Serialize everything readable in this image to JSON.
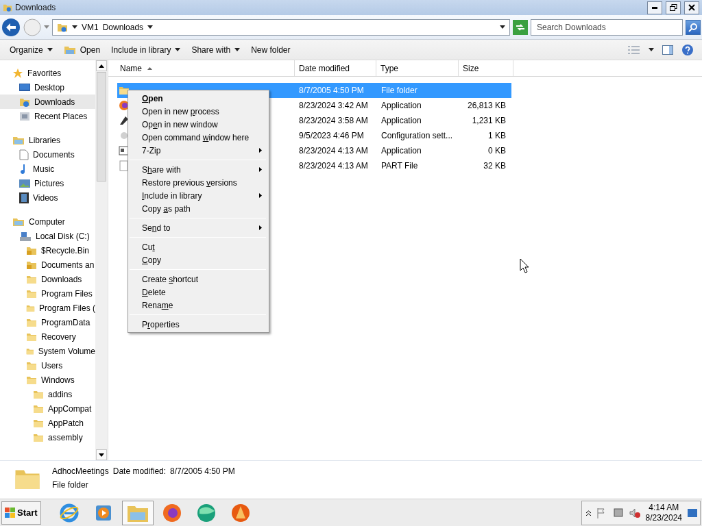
{
  "window": {
    "title": "Downloads"
  },
  "address": {
    "crumbs": [
      "VM1",
      "Downloads"
    ]
  },
  "search": {
    "placeholder": "Search Downloads"
  },
  "toolbar": {
    "buttons": [
      {
        "label": "Organize",
        "kind": "menu"
      },
      {
        "label": "Open",
        "kind": "open"
      },
      {
        "label": "Include in library",
        "kind": "menu"
      },
      {
        "label": "Share with",
        "kind": "menu"
      },
      {
        "label": "New folder",
        "kind": "plain"
      }
    ]
  },
  "sidebar": {
    "groups": [
      {
        "label": "Favorites",
        "kind": "star",
        "selected": false,
        "children": [
          {
            "label": "Desktop",
            "kind": "desktop",
            "selected": false
          },
          {
            "label": "Downloads",
            "kind": "download",
            "selected": true
          },
          {
            "label": "Recent Places",
            "kind": "recent",
            "selected": false
          }
        ]
      },
      {
        "label": "Libraries",
        "kind": "library",
        "selected": false,
        "children": [
          {
            "label": "Documents",
            "kind": "document",
            "selected": false
          },
          {
            "label": "Music",
            "kind": "music",
            "selected": false
          },
          {
            "label": "Pictures",
            "kind": "picture",
            "selected": false
          },
          {
            "label": "Videos",
            "kind": "video",
            "selected": false
          }
        ]
      },
      {
        "label": "Computer",
        "kind": "computer",
        "selected": false,
        "children": [
          {
            "label": "Local Disk (C:)",
            "kind": "drive",
            "selected": false,
            "children": [
              {
                "label": "$Recycle.Bin",
                "kind": "locked",
                "selected": false
              },
              {
                "label": "Documents an",
                "kind": "locked",
                "selected": false
              },
              {
                "label": "Downloads",
                "kind": "folder",
                "selected": false
              },
              {
                "label": "Program Files",
                "kind": "folder",
                "selected": false
              },
              {
                "label": "Program Files (",
                "kind": "folder",
                "selected": false
              },
              {
                "label": "ProgramData",
                "kind": "folder",
                "selected": false
              },
              {
                "label": "Recovery",
                "kind": "folder",
                "selected": false
              },
              {
                "label": "System Volume",
                "kind": "folder",
                "selected": false
              },
              {
                "label": "Users",
                "kind": "folder",
                "selected": false
              },
              {
                "label": "Windows",
                "kind": "folder",
                "selected": false,
                "children": [
                  {
                    "label": "addins",
                    "kind": "folder",
                    "selected": false
                  },
                  {
                    "label": "AppCompat",
                    "kind": "folder",
                    "selected": false
                  },
                  {
                    "label": "AppPatch",
                    "kind": "folder",
                    "selected": false
                  },
                  {
                    "label": "assembly",
                    "kind": "folder",
                    "selected": false
                  }
                ]
              }
            ]
          }
        ]
      }
    ]
  },
  "table": {
    "columns": [
      "Name",
      "Date modified",
      "Type",
      "Size"
    ],
    "rows": [
      {
        "date": "8/7/2005 4:50 PM",
        "type": "File folder",
        "kind": "folder",
        "selected": true
      },
      {
        "date": "8/23/2024 3:42 AM",
        "type": "Application",
        "size": "26,813 KB",
        "kind": "firefox",
        "selected": false
      },
      {
        "date": "8/23/2024 3:58 AM",
        "type": "Application",
        "size": "1,231 KB",
        "kind": "app",
        "selected": false
      },
      {
        "date": "9/5/2023 4:46 PM",
        "type": "Configuration sett...",
        "size": "1 KB",
        "kind": "config",
        "selected": false
      },
      {
        "date": "8/23/2024 4:13 AM",
        "type": "Application",
        "size": "0 KB",
        "kind": "window",
        "selected": false
      },
      {
        "date": "8/23/2024 4:13 AM",
        "type": "PART File",
        "size": "32 KB",
        "kind": "blank",
        "selected": false
      }
    ]
  },
  "context_menu": {
    "items": [
      {
        "kind": "item",
        "key": "O",
        "post": "pen",
        "bold": true
      },
      {
        "kind": "item",
        "pre": "Open in new ",
        "key": "p",
        "post": "rocess"
      },
      {
        "kind": "item",
        "pre": "Op",
        "key": "e",
        "post": "n in new window"
      },
      {
        "kind": "item",
        "pre": "Open command ",
        "key": "w",
        "post": "indow here"
      },
      {
        "kind": "submenu",
        "pre": "7-Zip"
      },
      {
        "kind": "separator"
      },
      {
        "kind": "submenu",
        "pre": "S",
        "key": "h",
        "post": "are with"
      },
      {
        "kind": "item",
        "pre": "Restore previous ",
        "key": "v",
        "post": "ersions"
      },
      {
        "kind": "submenu",
        "key": "I",
        "post": "nclude in library"
      },
      {
        "kind": "item",
        "pre": "Copy ",
        "key": "a",
        "post": "s path"
      },
      {
        "kind": "separator"
      },
      {
        "kind": "submenu",
        "pre": "Se",
        "key": "n",
        "post": "d to"
      },
      {
        "kind": "separator"
      },
      {
        "kind": "item",
        "pre": "Cu",
        "key": "t"
      },
      {
        "kind": "item",
        "key": "C",
        "post": "opy"
      },
      {
        "kind": "separator"
      },
      {
        "kind": "item",
        "pre": "Create ",
        "key": "s",
        "post": "hortcut"
      },
      {
        "kind": "item",
        "key": "D",
        "post": "elete"
      },
      {
        "kind": "item",
        "pre": "Rena",
        "key": "m",
        "post": "e"
      },
      {
        "kind": "separator"
      },
      {
        "kind": "item",
        "pre": "P",
        "key": "r",
        "post": "operties"
      }
    ]
  },
  "details": {
    "name": "AdhocMeetings",
    "date_label": "Date modified:",
    "date": "8/7/2005 4:50 PM",
    "type": "File folder"
  },
  "taskbar": {
    "start": "Start",
    "apps": [
      {
        "kind": "ie",
        "selected": false
      },
      {
        "kind": "media",
        "selected": false
      },
      {
        "kind": "explorer",
        "selected": true
      },
      {
        "kind": "firefox",
        "selected": false
      },
      {
        "kind": "globe",
        "selected": false
      },
      {
        "kind": "vlc",
        "selected": false
      }
    ],
    "clock": {
      "time": "4:14 AM",
      "date": "8/23/2024"
    }
  }
}
